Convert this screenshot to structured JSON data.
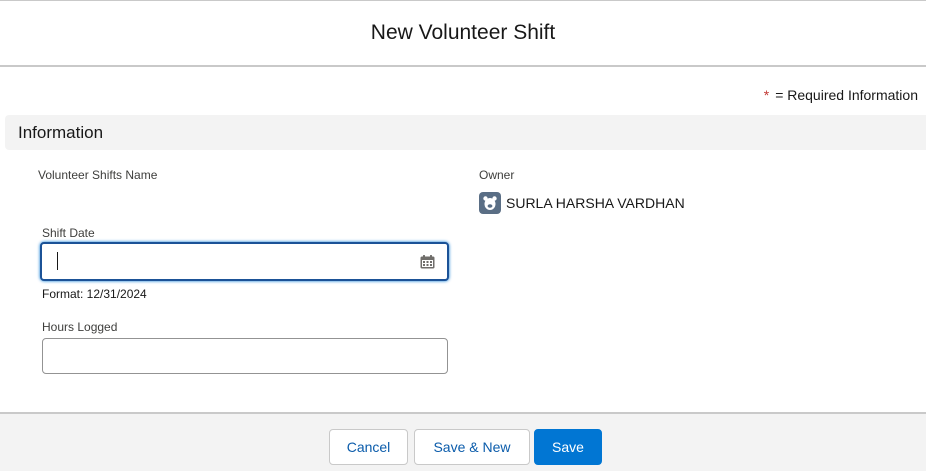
{
  "modal": {
    "title": "New Volunteer Shift",
    "required_legend": {
      "asterisk": "*",
      "text": "= Required Information"
    }
  },
  "section": {
    "title": "Information"
  },
  "fields": {
    "volunteer_shifts_name": {
      "label": "Volunteer Shifts Name"
    },
    "owner": {
      "label": "Owner",
      "value": "SURLA HARSHA VARDHAN",
      "icon": "user-avatar-icon"
    },
    "shift_date": {
      "label": "Shift Date",
      "value": "",
      "help_text": "Format: 12/31/2024",
      "icon": "calendar-icon"
    },
    "hours_logged": {
      "label": "Hours Logged",
      "value": ""
    }
  },
  "footer": {
    "cancel_label": "Cancel",
    "save_new_label": "Save & New",
    "save_label": "Save"
  },
  "colors": {
    "brand": "#0176d3",
    "focus_border": "#1b5297",
    "required": "#c23934",
    "section_bg": "#f3f3f3",
    "avatar_bg": "#5a6e85"
  }
}
